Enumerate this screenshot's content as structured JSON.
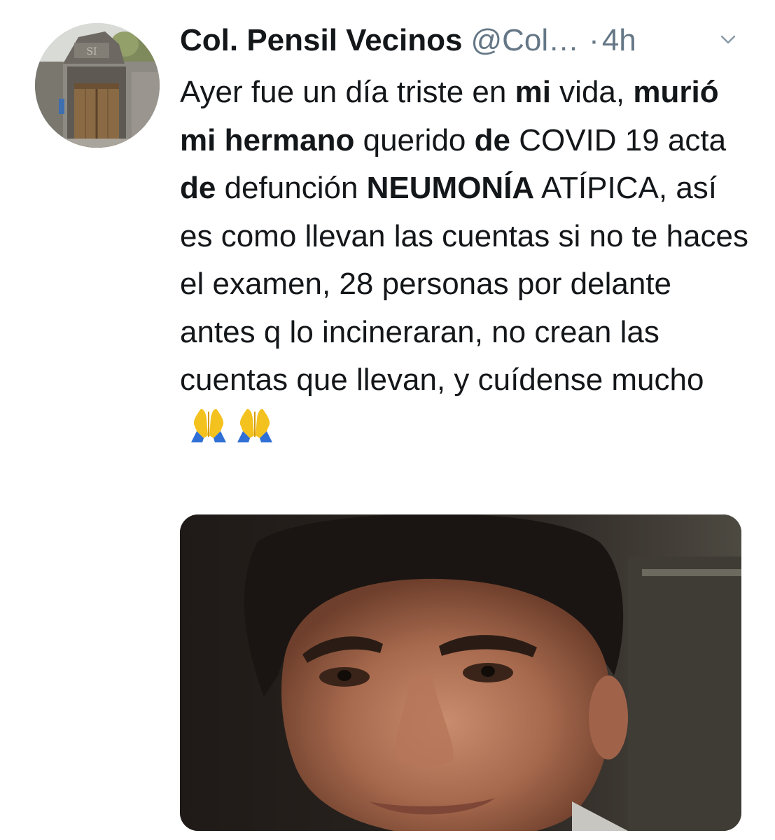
{
  "tweet": {
    "display_name": "Col. Pensil Vecinos",
    "handle": "@Col…",
    "separator": "·",
    "time": "4h",
    "text_segments": [
      {
        "text": "Ayer fue un día triste en ",
        "bold": false
      },
      {
        "text": "mi",
        "bold": true
      },
      {
        "text": " vida, ",
        "bold": false
      },
      {
        "text": "murió mi hermano",
        "bold": true
      },
      {
        "text": " querido ",
        "bold": false
      },
      {
        "text": "de",
        "bold": true
      },
      {
        "text": " COVID 19 acta ",
        "bold": false
      },
      {
        "text": "de",
        "bold": true
      },
      {
        "text": " defunción ",
        "bold": false
      },
      {
        "text": "NEUMONÍA",
        "bold": true
      },
      {
        "text": " ATÍPICA, así es como llevan las cuentas si no te haces el examen, 28 personas por delante antes q lo incineraran, no crean las cuentas que llevan, y cuídense mucho",
        "bold": false
      }
    ],
    "emojis": [
      "folded-hands-icon",
      "folded-hands-icon"
    ],
    "avatar": "building-gate-photo",
    "media": "portrait-photo",
    "menu_icon": "chevron-down-icon"
  },
  "colors": {
    "text": "#14171a",
    "secondary": "#657786",
    "background": "#ffffff"
  }
}
